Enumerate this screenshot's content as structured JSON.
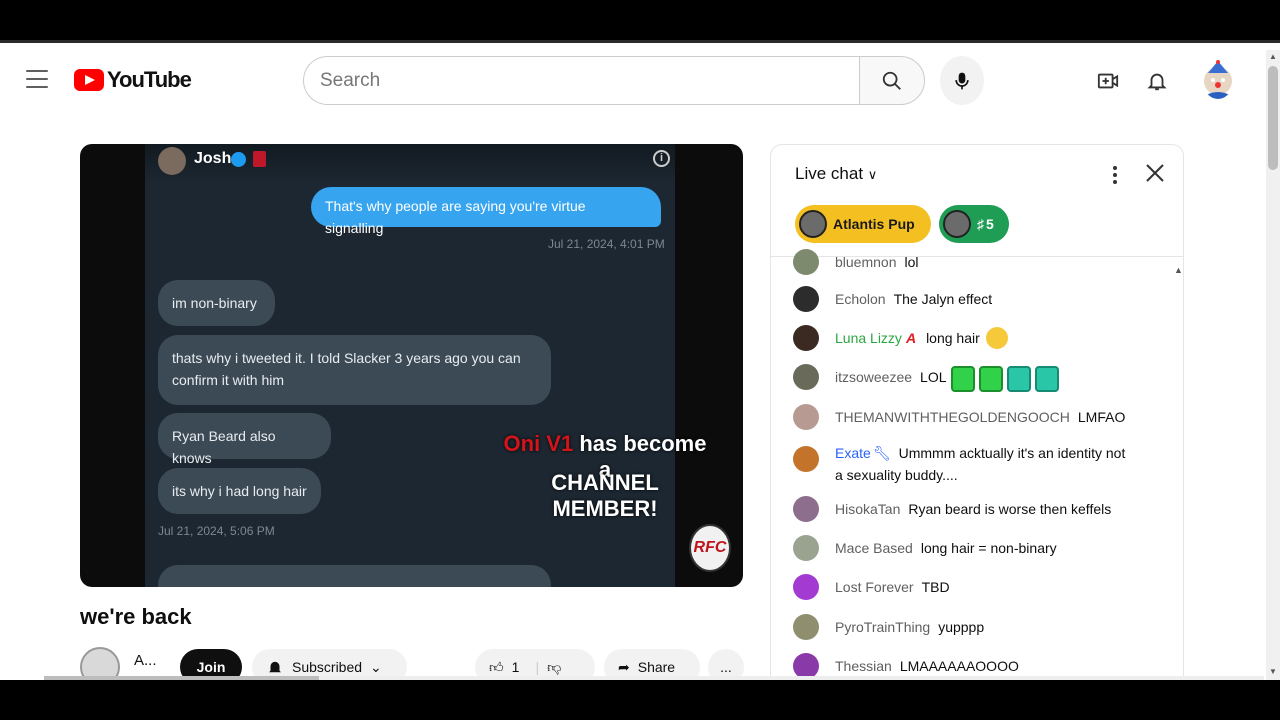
{
  "header": {
    "logo_text": "YouTube",
    "search_placeholder": "Search"
  },
  "video": {
    "poster_name": "Josh",
    "bubbles": {
      "sent": "That's why people are saying you're virtue signalling",
      "sent_time": "Jul 21, 2024, 4:01 PM",
      "r1": "im non-binary",
      "r2": "thats why i tweeted it. I told Slacker 3 years ago you can confirm it with him",
      "r3": "Ryan Beard also knows",
      "r4": "its why i had long hair",
      "recv_time": "Jul 21, 2024, 5:06 PM"
    },
    "overlay": {
      "member_name": "Oni V1",
      "line1_rest": " has become a",
      "line2": "CHANNEL  MEMBER!"
    },
    "watermark": "RFC"
  },
  "below_video": {
    "title": "we're back",
    "channel_name": "A...",
    "join_label": "Join",
    "subscribed_label": "Subscribed",
    "like_count": "1",
    "share_label": "Share",
    "more_label": "..."
  },
  "chat": {
    "title": "Live chat",
    "pills": [
      {
        "label": "Atlantis Pup",
        "color": "#f4c021"
      },
      {
        "label": "5",
        "color": "#1f9d55"
      }
    ],
    "messages": [
      {
        "author": "bluemnon",
        "text": "lol",
        "avatar_color": "#7e8a6e"
      },
      {
        "author": "Echolon",
        "text": "The Jalyn effect",
        "avatar_color": "#2c2c2c"
      },
      {
        "author": "Luna Lizzy",
        "text": "long hair",
        "avatar_color": "#3a2a22"
      },
      {
        "author": "itzsoweezee",
        "text": "LOL",
        "avatar_color": "#6a6a5a"
      },
      {
        "author": "THEMANWITHTHEGOLDENGOOCH",
        "text": "LMFAO",
        "avatar_color": "#b79b93"
      },
      {
        "author": "Exate",
        "text": "Ummmm acktually it's an identity not a sexuality buddy....",
        "avatar_color": "#c4742a"
      },
      {
        "author": "HisokaTan",
        "text": "Ryan beard is worse then keffels",
        "avatar_color": "#8d6f8d"
      },
      {
        "author": "Mace Based",
        "text": "long hair = non-binary",
        "avatar_color": "#9aa38f"
      },
      {
        "author": "Lost Forever",
        "text": "TBD",
        "avatar_color": "#a33ad1"
      },
      {
        "author": "PyroTrainThing",
        "text": "yupppp",
        "avatar_color": "#8f8f6f"
      },
      {
        "author": "Thessian",
        "text": "LMAAAAAAOOOO",
        "avatar_color": "#8a3aa8"
      }
    ]
  }
}
